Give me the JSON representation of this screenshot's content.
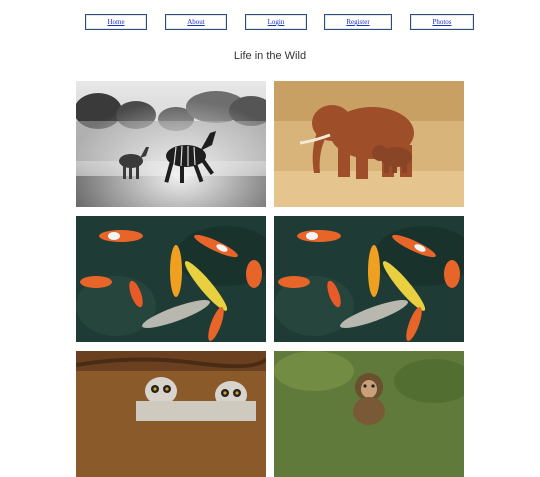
{
  "nav": {
    "home": "Home",
    "about": "About",
    "login": "Login",
    "register": "Register",
    "photos": "Photos"
  },
  "page": {
    "title": "Life in the Wild"
  },
  "photos": [
    {
      "subject": "zebras-running-in-dust"
    },
    {
      "subject": "elephant-and-calf"
    },
    {
      "subject": "koi-fish"
    },
    {
      "subject": "koi-fish"
    },
    {
      "subject": "ring-tailed-lemurs"
    },
    {
      "subject": "baby-monkey"
    }
  ],
  "colors": {
    "nav_border": "#2f4d7a",
    "link": "#1a2fc4",
    "title_text": "#333333"
  }
}
